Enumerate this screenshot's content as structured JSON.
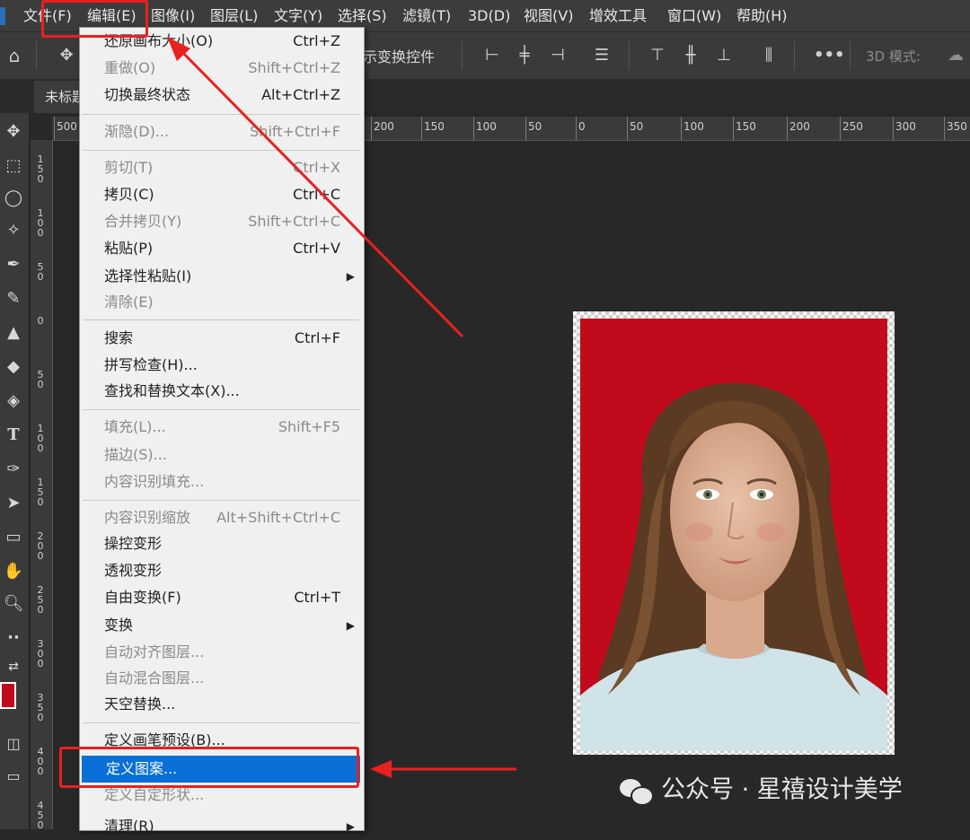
{
  "menubar": {
    "items": [
      "文件(F)",
      "编辑(E)",
      "图像(I)",
      "图层(L)",
      "文字(Y)",
      "选择(S)",
      "滤镜(T)",
      "3D(D)",
      "视图(V)",
      "增效工具",
      "窗口(W)",
      "帮助(H)"
    ]
  },
  "options_bar": {
    "transform_controls_label": "示变换控件",
    "mode_3d_label": "3D 模式:"
  },
  "tab": {
    "title": "未标题"
  },
  "ruler": {
    "h_ticks": [
      "500",
      "200",
      "150",
      "100",
      "50",
      "0",
      "50",
      "100",
      "150",
      "200",
      "250",
      "300",
      "350"
    ],
    "v_ticks": [
      "150",
      "100",
      "50",
      "0",
      "50",
      "100",
      "150",
      "200",
      "250",
      "300",
      "350",
      "400",
      "450"
    ]
  },
  "edit_menu": {
    "items": [
      {
        "label": "还原画布大小(O)",
        "shortcut": "Ctrl+Z",
        "disabled": false
      },
      {
        "label": "重做(O)",
        "shortcut": "Shift+Ctrl+Z",
        "disabled": true
      },
      {
        "label": "切换最终状态",
        "shortcut": "Alt+Ctrl+Z",
        "disabled": false
      },
      {
        "label": "渐隐(D)...",
        "shortcut": "Shift+Ctrl+F",
        "disabled": true
      },
      {
        "label": "剪切(T)",
        "shortcut": "Ctrl+X",
        "disabled": true
      },
      {
        "label": "拷贝(C)",
        "shortcut": "Ctrl+C",
        "disabled": false
      },
      {
        "label": "合并拷贝(Y)",
        "shortcut": "Shift+Ctrl+C",
        "disabled": true
      },
      {
        "label": "粘贴(P)",
        "shortcut": "Ctrl+V",
        "disabled": false
      },
      {
        "label": "选择性粘贴(I)",
        "shortcut": "",
        "disabled": false
      },
      {
        "label": "清除(E)",
        "shortcut": "",
        "disabled": true
      },
      {
        "label": "搜索",
        "shortcut": "Ctrl+F",
        "disabled": false
      },
      {
        "label": "拼写检查(H)...",
        "shortcut": "",
        "disabled": false
      },
      {
        "label": "查找和替换文本(X)...",
        "shortcut": "",
        "disabled": false
      },
      {
        "label": "填充(L)...",
        "shortcut": "Shift+F5",
        "disabled": true
      },
      {
        "label": "描边(S)...",
        "shortcut": "",
        "disabled": true
      },
      {
        "label": "内容识别填充...",
        "shortcut": "",
        "disabled": true
      },
      {
        "label": "内容识别缩放",
        "shortcut": "Alt+Shift+Ctrl+C",
        "disabled": true
      },
      {
        "label": "操控变形",
        "shortcut": "",
        "disabled": false
      },
      {
        "label": "透视变形",
        "shortcut": "",
        "disabled": false
      },
      {
        "label": "自由变换(F)",
        "shortcut": "Ctrl+T",
        "disabled": false
      },
      {
        "label": "变换",
        "shortcut": "",
        "disabled": false
      },
      {
        "label": "自动对齐图层...",
        "shortcut": "",
        "disabled": true
      },
      {
        "label": "自动混合图层...",
        "shortcut": "",
        "disabled": true
      },
      {
        "label": "天空替换...",
        "shortcut": "",
        "disabled": false
      },
      {
        "label": "定义画笔预设(B)...",
        "shortcut": "",
        "disabled": false
      },
      {
        "label": "定义图案...",
        "shortcut": "",
        "disabled": false,
        "highlighted": true
      },
      {
        "label": "定义自定形状...",
        "shortcut": "",
        "disabled": true
      },
      {
        "label": "清理(R)",
        "shortcut": "",
        "disabled": false
      }
    ]
  },
  "watermark": {
    "text": "公众号 · 星禧设计美学"
  },
  "colors": {
    "accent": "#0a6fd6",
    "annotation": "#e8211f",
    "photo_bg": "#c10a1c",
    "foreground_swatch": "#c10a1c"
  }
}
